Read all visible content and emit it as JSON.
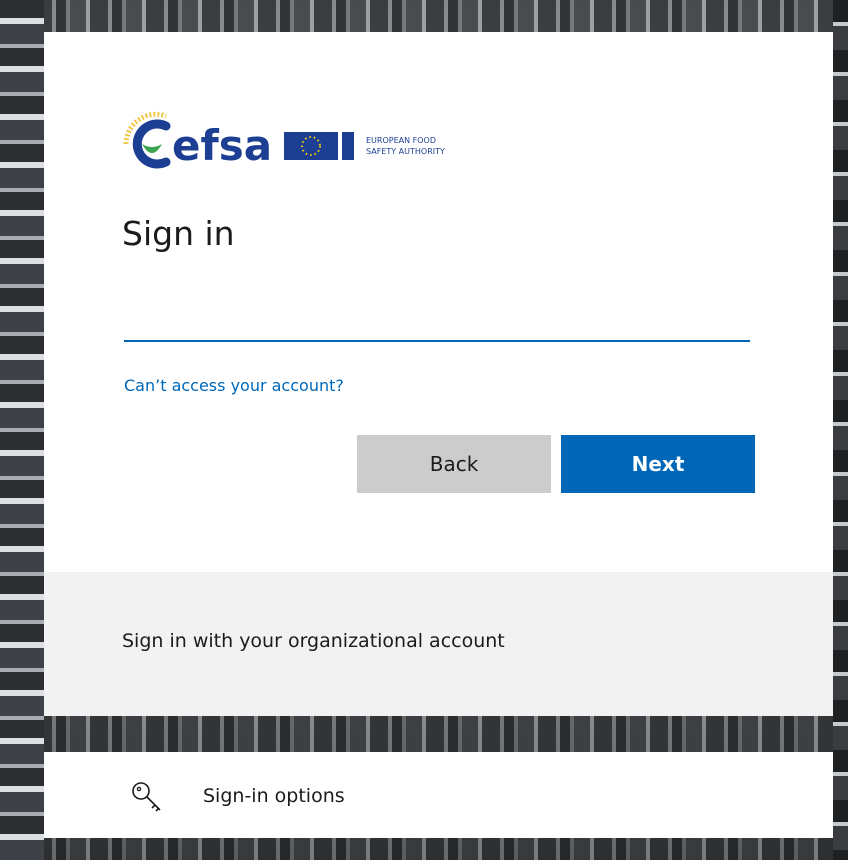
{
  "logo": {
    "wordmark": "efsa",
    "tagline_line1": "EUROPEAN FOOD",
    "tagline_line2": "SAFETY AUTHORITY",
    "colors": {
      "brand_blue": "#1c3f94",
      "leaf_green": "#3ca64f",
      "arc_yellow": "#f2c84b",
      "eu_blue": "#1c3f94",
      "eu_star": "#ffd200"
    }
  },
  "signin": {
    "title": "Sign in",
    "email_value": "",
    "email_placeholder": ""
  },
  "links": {
    "cant_access": "Can’t access your account?"
  },
  "buttons": {
    "back": "Back",
    "next": "Next"
  },
  "footer": {
    "org_text": "Sign in with your organizational account"
  },
  "options": {
    "label": "Sign-in options",
    "icon": "key-icon"
  },
  "colors": {
    "accent": "#0067b8",
    "back_button": "#cccccc",
    "footer_bg": "#f2f2f2"
  }
}
